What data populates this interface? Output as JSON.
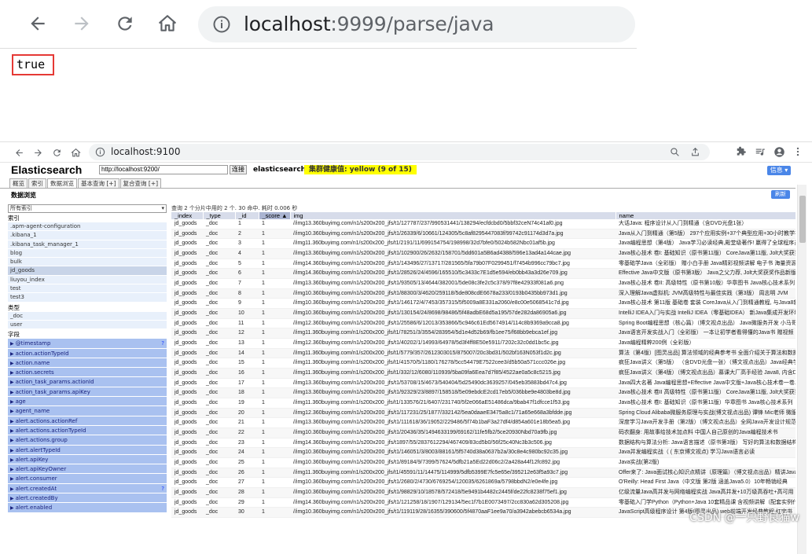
{
  "top_browser": {
    "url_host": "localhost",
    "url_rest": ":9999/parse/java",
    "page_output": "true"
  },
  "bottom_browser": {
    "url": "localhost:9100",
    "app": {
      "logo": "Elasticsearch",
      "connect_url": "http://localhost:9200/",
      "connect_label": "连接",
      "cluster_name": "elasticsearch",
      "health": "集群健康值: yellow (9 of 15)",
      "info_button": "信息 ▾",
      "tabs": [
        "概览",
        "索引",
        "数据浏览",
        "基本查询 [+]",
        "复合查询 [+]"
      ],
      "section_title": "数据浏览",
      "refresh_label": "刷新",
      "index_select": "所有索引",
      "index_heading": "索引",
      "indices": [
        ".apm-agent-configuration",
        ".kibana_1",
        ".kibana_task_manager_1",
        "blog",
        "bulk",
        "jd_goods",
        "liuyou_index",
        "test",
        "test3"
      ],
      "type_heading": "类型",
      "types": [
        "_doc",
        "user"
      ],
      "field_heading": "字段",
      "fields": [
        "@timestamp",
        "action.actionTypeId",
        "action.name",
        "action.secrets",
        "action_task_params.actionId",
        "action_task_params.apiKey",
        "age",
        "agent_name",
        "alert.actions.actionRef",
        "alert.actions.actionTypeId",
        "alert.actions.group",
        "alert.alertTypeId",
        "alert.apiKey",
        "alert.apiKeyOwner",
        "alert.consumer",
        "alert.createdAt",
        "alert.createdBy",
        "alert.enabled"
      ],
      "query_info": "查询 2 个分片中用的 2 个. 30 命中. 耗时 0.006 秒",
      "columns": [
        "_index",
        "_type",
        "_id",
        "_score ▲",
        "img",
        "name"
      ],
      "rows": [
        [
          "jd_goods",
          "_doc",
          "1",
          "1",
          "//img13.360buyimg.com/n1/s200x200_jfs/t1/127787/237/990531441/138294/ecfdcbd0/5bbf32ceN74c41af0.jpg",
          "大话Java: 程序设计从入门到精通（含DVD光盘1张）"
        ],
        [
          "jd_goods",
          "_doc",
          "2",
          "1",
          "//img10.360buyimg.com/n1/s200x200_jfs/t1/26339/6/10661/124305/5c8af8295447083f/99742c91174d3d7a.jpg",
          "Java从入门到精通（第5版） 297个应用实例+37个典型应用+30小时教学视频"
        ],
        [
          "jd_goods",
          "_doc",
          "3",
          "1",
          "//img11.360buyimg.com/n1/s200x200_jfs/t1/2191/11/699154754/198998/32d7bfe0/5024b582Nbc01af5b.jpg",
          "Java编程思想（第4版） Java学习必读经典,殿堂级著作! 赢得了全球程序员的广泛赞誉"
        ],
        [
          "jd_goods",
          "_doc",
          "4",
          "1",
          "//img13.360buyimg.com/n1/s200x200_jfs/t1/102900/26/2632/158701/5dd601a5B6ad4388/596e13ad4a144cae.jpg",
          "Java核心技术 卷I: 基础知识（原书第11版） CoreJava第11版, Jolt大奖获奖作品"
        ],
        [
          "jd_goods",
          "_doc",
          "5",
          "1",
          "//img14.360buyimg.com/n1/s200x200_jfs/t1/143496/27/13717/281565/5fa79b07F0299451/f7454b996cc79bc7.jpg",
          "零基础学Java（全彩版） 赠小白手册 Java精彩视频讲解 电子书 海量资源"
        ],
        [
          "jd_goods",
          "_doc",
          "6",
          "1",
          "//img14.360buyimg.com/n1/s200x200_jfs/t1/28526/24/4596/165510/5c3433c7E1d5e594/eb0bb43a3d26e709.jpg",
          "Effective Java中文版（原书第3版） Java之父力荐, Jolt大奖获奖作品新版"
        ],
        [
          "jd_goods",
          "_doc",
          "7",
          "1",
          "//img13.360buyimg.com/n1/s200x200_jfs/t1/93505/13/4644/382001/5de08c3fe2c5c378/97f8e42933f081a6.png",
          "Java核心技术 卷II: 高级特性（原书第10版）华章图书 Java核心技术系列"
        ],
        [
          "jd_goods",
          "_doc",
          "8",
          "1",
          "//img10.360buyimg.com/n1/s200x200_jfs/t1/88300/3/4620/259118/5de808cdE6678a233/0193b0435bb973d1.jpg",
          "深入理解Java虚拟机: JVM高级特性与最佳实践（第3版） 周志明 JVM"
        ],
        [
          "jd_goods",
          "_doc",
          "9",
          "1",
          "//img10.360buyimg.com/n1/s200x200_jfs/t1/146172/4/7453/357315/5f5009a8E331a2060/e8c00e5068541c7d.jpg",
          "Java核心技术 第11版 基础卷 套装 CoreJava从入门到精通教程, 与Java8新特性"
        ],
        [
          "jd_goods",
          "_doc",
          "10",
          "1",
          "//img10.360buyimg.com/n1/s200x200_jfs/t1/130154/24/8698/98486/5f48adbE68d5a195/57de282da86905a6.jpg",
          "IntelliJ IDEA入门与实战 IntelliJ IDEA（零基础IDEA） 新Java集成开发环境"
        ],
        [
          "jd_goods",
          "_doc",
          "11",
          "1",
          "//img12.360buyimg.com/n1/s200x200_jfs/t1/25586/6/12013/353866/5c946c61Ed5674914/114c8b9369a9cca8.jpg",
          "Spring Boot编程思想（核心篇）（博文视点出品） Java微服务开发 小马哥"
        ],
        [
          "jd_goods",
          "_doc",
          "12",
          "1",
          "//img11.360buyimg.com/n1/s200x200_jfs/t1/78251/3/3554/283954/5d1e4d52b69/fb1ee75/f68bb9ebca1ef.jpg",
          "Java语言开发实战入门（全彩版） 一本让初学者看得懂的Java书 赠视频"
        ],
        [
          "jd_goods",
          "_doc",
          "13",
          "1",
          "//img12.360buyimg.com/n1/s200x200_jfs/t1/40202/1/14993/64978/5d3f4ff8E50e5911/7202c32c0dd1bc5c.jpg",
          "Java编程精粹200例（全彩版）"
        ],
        [
          "jd_goods",
          "_doc",
          "14",
          "1",
          "//img11.360buyimg.com/n1/s200x200_jfs/t1/5779/357/2612303015/875007/20c3bd31/502bf163N053f1d2c.jpg",
          "算法（第4版）[图灵出品] 算法领域的经典参考书 全面介绍关于算法和数据结构"
        ],
        [
          "jd_goods",
          "_doc",
          "15",
          "1",
          "//img11.360buyimg.com/n1/s200x200_jfs/t1/41570/5/1180/176278/5cc54479E7522cee3/d5b50a571ccc026e.jpg",
          "疯狂Java讲义（第5版） （含DVD光盘一张）（博文视点出品）Java经典学习教程"
        ],
        [
          "jd_goods",
          "_doc",
          "16",
          "1",
          "//img11.360buyimg.com/n1/s200x200_jfs/t1/332/12/6080/110939/5ba09fa6Eea7d7f85/4522ae0a5c8c5215.jpg",
          "疯狂Java讲义（第4版）（博文视点出品）慕课大厂高手经验 Java8, 内含DVD"
        ],
        [
          "jd_goods",
          "_doc",
          "17",
          "1",
          "//img13.360buyimg.com/n1/s200x200_jfs/t1/53708/15/4673/540404/5d25490dc3639257/045eb35883bd47c4.jpg",
          "Java四大名著 Java编程思想+Effective Java中文版+Java核心技术卷一卷二"
        ],
        [
          "jd_goods",
          "_doc",
          "18",
          "1",
          "//img13.360buyimg.com/n1/s200x200_jfs/t1/92329/23/8897/158518/5e09ebdcE2cd17eb5/036bbe9e4803be8d.jpg",
          "Java核心技术 卷II 高级特性（原书第11版） CoreJava第11版, Jolt大奖获奖作品"
        ],
        [
          "jd_goods",
          "_doc",
          "19",
          "1",
          "//img11.360buyimg.com/n1/s200x200_jfs/t1/133576/21/6407/231740/5f2e066aE51486dca/9bab47f1dfcce1f53.jpg",
          "Java核心技术 卷I: 基础知识（原书第11版）华章图书 Java核心技术系列"
        ],
        [
          "jd_goods",
          "_doc",
          "20",
          "1",
          "//img12.360buyimg.com/n1/s200x200_jfs/t1/117231/25/1877/332142/5ea0daaeE3475a8c1/71a65e668a3bfdde.jpg",
          "Spring Cloud Alibaba微服务原理与实战(博文视点出品) 谭锋 Mic老师 微服务"
        ],
        [
          "jd_goods",
          "_doc",
          "21",
          "1",
          "//img13.360buyimg.com/n1/s200x200_jfs/t1/111618/36/19052/229486/5f74b1baF3a27df4/d854a601e18b5ea5.jpg",
          "深度学习Java开发手册（第2版）（博文视点出品）全网Java开发设计规范 阿里巴巴"
        ],
        [
          "jd_goods",
          "_doc",
          "22",
          "1",
          "//img10.360buyimg.com/n1/s200x200_jfs/t1/20436/35/1494633199/69162/11fe5fb2/5ce20930Nbd70a9fb.jpg",
          "码农翻身: 用故事给技术加点料 中国人自己原创的Java编程技术书"
        ],
        [
          "jd_goods",
          "_doc",
          "23",
          "1",
          "//img14.360buyimg.com/n1/s200x200_jfs/t1897/55/2837612294/467409/83cd5b0/56f25c40Nc3b3c506.jpg",
          "数据结构与算法分析: Java语言描述（原书第3版） 写好的算法和数据结构的经典"
        ],
        [
          "jd_goods",
          "_doc",
          "24",
          "1",
          "//img10.360buyimg.com/n1/s200x200_jfs/t1/146051/3/8003/88161/5f5740d38a0637b2a/30c8e4c980bc92c35.jpg",
          "Java并发编程实战（ ( 东京博文视点) 学习Java语言必读"
        ],
        [
          "jd_goods",
          "_doc",
          "25",
          "1",
          "//img10.360buyimg.com/n1/s200x200_jfs/t1/89184/9/7399/57624/5dfb21a5Ed22d06c2/2a428a44f12fc892.jpg",
          "Java实战(第2版)"
        ],
        [
          "jd_goods",
          "_doc",
          "26",
          "1",
          "//img11.360buyimg.com/n1/s200x200_jfs/t1/45591/11/14475/114999/5dfb5399E7fc5e65e/395212e63f5a93c7.jpg",
          "Offer来了: Java面试核心知识点精讲（原理篇）（博文视点出品）精讲Java面试"
        ],
        [
          "jd_goods",
          "_doc",
          "27",
          "1",
          "//img10.360buyimg.com/n1/s200x200_jfs/t1/2680/2/4730/6769254/120035/6261869a/5798bbdN2/e0e4fe.jpg",
          "O'Reilly: Head First Java（中文版 第2版 涵盖Java5.0）10年畅销经典"
        ],
        [
          "jd_goods",
          "_doc",
          "28",
          "1",
          "//img10.360buyimg.com/n1/s200x200_jfs/t1/98829/10/18578/572418/5e9491b4482c2445f/de22fc8238f75ef1.jpg",
          "亿级流量Java高并发与网络编程实战 Java高并发+10万级高吞吐+高可用"
        ],
        [
          "jd_goods",
          "_doc",
          "29",
          "1",
          "//img14.360buyimg.com/n1/s200x200_jfs/t1/121258/18/1907/129134/5ec1f7b1E0073497/2cc830a62d305208.jpg",
          "零基础入门学Python（Python+Java 10套精品课 含视频讲解（配套实例代码）"
        ],
        [
          "jd_goods",
          "_doc",
          "30",
          "1",
          "//img10.360buyimg.com/n1/s200x200_jfs/t1/119119/28/16355/390600/5f4870aaF1ee9a70/a3942abebcb6534a.jpg",
          "JavaScript高级程序设计 第4版(图灵出品) web前端开发经典教程 红宝书"
        ]
      ]
    }
  },
  "watermark": "CSDN @一只野良猫w"
}
